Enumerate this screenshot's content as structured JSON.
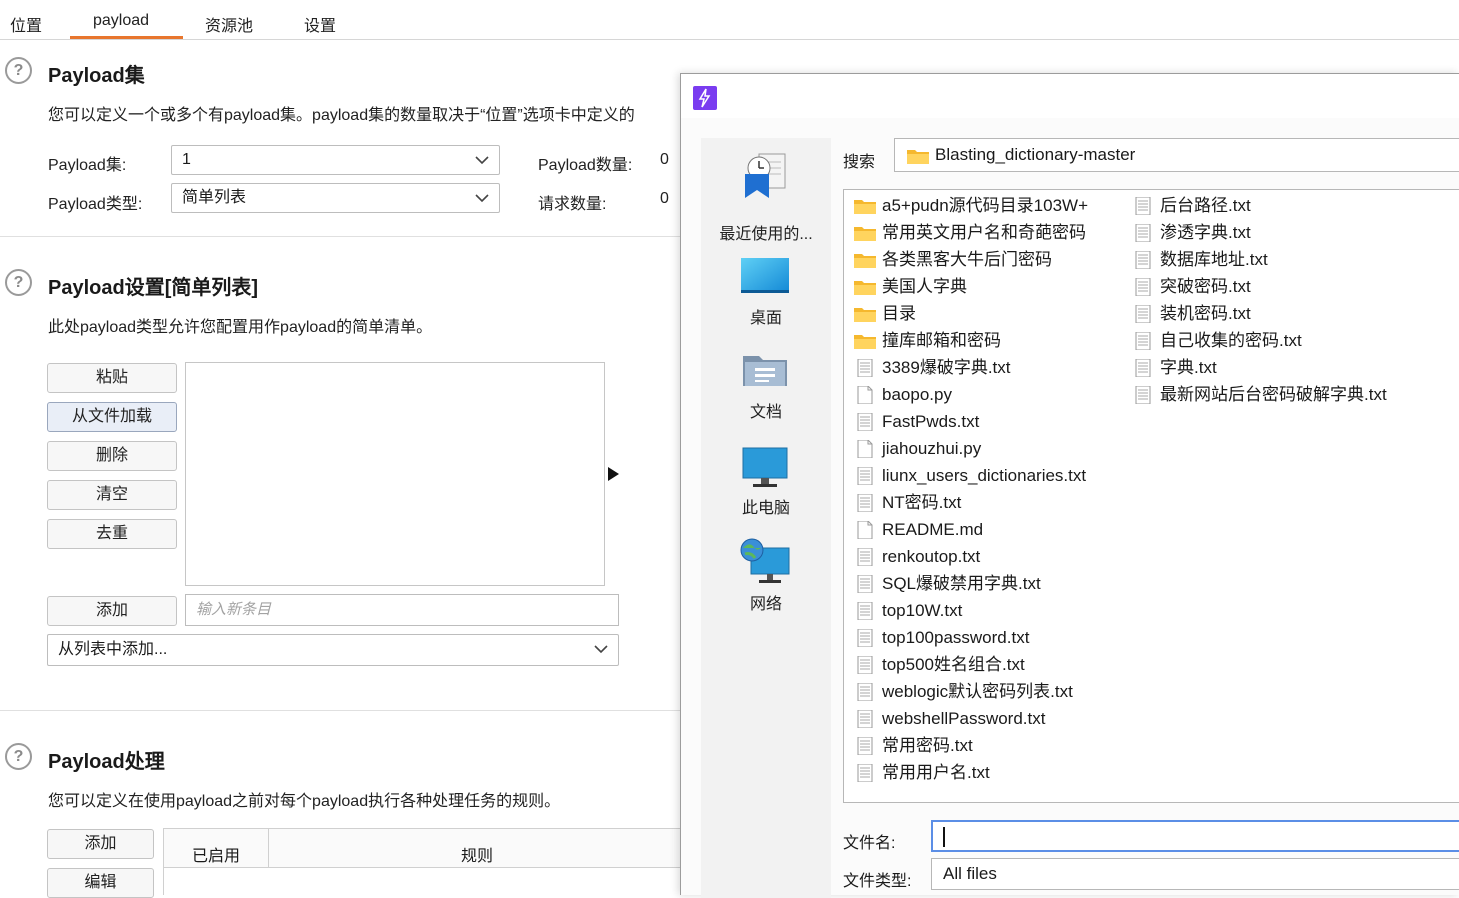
{
  "tabs": [
    "位置",
    "payload",
    "资源池",
    "设置"
  ],
  "payload_sets": {
    "title": "Payload集",
    "description": "您可以定义一个或多个有payload集。payload集的数量取决于“位置”选项卡中定义的",
    "set_label": "Payload集:",
    "set_value": "1",
    "type_label": "Payload类型:",
    "type_value": "简单列表",
    "count_label": "Payload数量:",
    "count_value": "0",
    "request_label": "请求数量:",
    "request_value": "0"
  },
  "payload_settings": {
    "title": "Payload设置[简单列表]",
    "description": "此处payload类型允许您配置用作payload的简单清单。",
    "buttons": [
      "粘贴",
      "从文件加载",
      "删除",
      "清空",
      "去重"
    ],
    "add_button": "添加",
    "new_entry_placeholder": "输入新条目",
    "add_from_list": "从列表中添加..."
  },
  "payload_processing": {
    "title": "Payload处理",
    "description": "您可以定义在使用payload之前对每个payload执行各种处理任务的规则。",
    "add_button": "添加",
    "edit_button": "编辑",
    "columns": [
      "已启用",
      "规则"
    ]
  },
  "file_dialog": {
    "search_label": "搜索",
    "current_folder": "Blasting_dictionary-master",
    "places": [
      "最近使用的...",
      "桌面",
      "文档",
      "此电脑",
      "网络"
    ],
    "files_col1": [
      {
        "name": "a5+pudn源代码目录103W+",
        "type": "folder"
      },
      {
        "name": "常用英文用户名和奇葩密码",
        "type": "folder"
      },
      {
        "name": "各类黑客大牛后门密码",
        "type": "folder"
      },
      {
        "name": "美国人字典",
        "type": "folder"
      },
      {
        "name": "目录",
        "type": "folder"
      },
      {
        "name": "撞库邮箱和密码",
        "type": "folder"
      },
      {
        "name": "3389爆破字典.txt",
        "type": "text"
      },
      {
        "name": "baopo.py",
        "type": "file"
      },
      {
        "name": "FastPwds.txt",
        "type": "text"
      },
      {
        "name": "jiahouzhui.py",
        "type": "file"
      },
      {
        "name": "liunx_users_dictionaries.txt",
        "type": "text"
      },
      {
        "name": "NT密码.txt",
        "type": "text"
      },
      {
        "name": "README.md",
        "type": "file"
      },
      {
        "name": "renkoutop.txt",
        "type": "text"
      },
      {
        "name": "SQL爆破禁用字典.txt",
        "type": "text"
      },
      {
        "name": "top10W.txt",
        "type": "text"
      },
      {
        "name": "top100password.txt",
        "type": "text"
      },
      {
        "name": "top500姓名组合.txt",
        "type": "text"
      },
      {
        "name": "weblogic默认密码列表.txt",
        "type": "text"
      },
      {
        "name": "webshellPassword.txt",
        "type": "text"
      },
      {
        "name": "常用密码.txt",
        "type": "text"
      },
      {
        "name": "常用用户名.txt",
        "type": "text"
      }
    ],
    "files_col2": [
      {
        "name": "后台路径.txt",
        "type": "text"
      },
      {
        "name": "渗透字典.txt",
        "type": "text"
      },
      {
        "name": "数据库地址.txt",
        "type": "text"
      },
      {
        "name": "突破密码.txt",
        "type": "text"
      },
      {
        "name": "装机密码.txt",
        "type": "text"
      },
      {
        "name": "自己收集的密码.txt",
        "type": "text"
      },
      {
        "name": "字典.txt",
        "type": "text"
      },
      {
        "name": "最新网站后台密码破解字典.txt",
        "type": "text"
      }
    ],
    "filename_label": "文件名:",
    "filename_value": "",
    "filetype_label": "文件类型:",
    "filetype_value": "All files"
  },
  "colors": {
    "accent": "#e8762d",
    "dialog_logo": "#7a3cf0",
    "focus": "#5b8ee6"
  }
}
